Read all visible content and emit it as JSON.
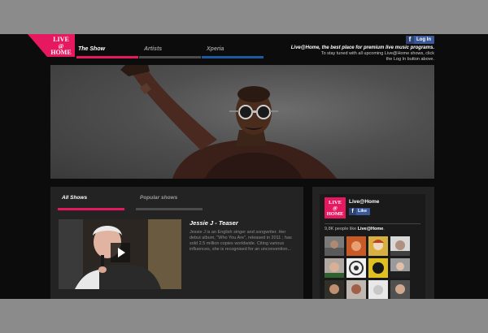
{
  "brand": {
    "logo_text_top": "LIVE",
    "logo_text_mid": "@",
    "logo_text_bottom": "HOME",
    "accent_color": "#e6185f",
    "secondary_color": "#205a9e"
  },
  "nav": {
    "tabs": [
      {
        "label": "The Show",
        "active": true
      },
      {
        "label": "Artists",
        "active": false
      },
      {
        "label": "Xperia",
        "active": false
      }
    ]
  },
  "header": {
    "login_label": "Log In",
    "login_icon": "facebook-f-icon",
    "tagline": "Live@Home, the best place for premium live music programs.",
    "subtext": "To stay tuned with all upcoming Live@Home shows, click the Log In button above."
  },
  "shows": {
    "tabs": [
      {
        "label": "All Shows",
        "active": true
      },
      {
        "label": "Popular shows",
        "active": false
      }
    ],
    "featured": {
      "title": "Jessie J - Teaser",
      "description": "Jessie J is an English singer and songwriter. Her debut album, \"Who You Are\", released in 2011 ; has sold 2.5 million copies worldwide. Citing various influences, she is recognised for an unconvention...",
      "play_icon": "play-icon"
    }
  },
  "facebook_box": {
    "page_name": "Live@Home",
    "like_label": "Like",
    "count_number": "9,8K",
    "count_text": " people like ",
    "count_page": "Live@Home",
    "count_end": "."
  }
}
